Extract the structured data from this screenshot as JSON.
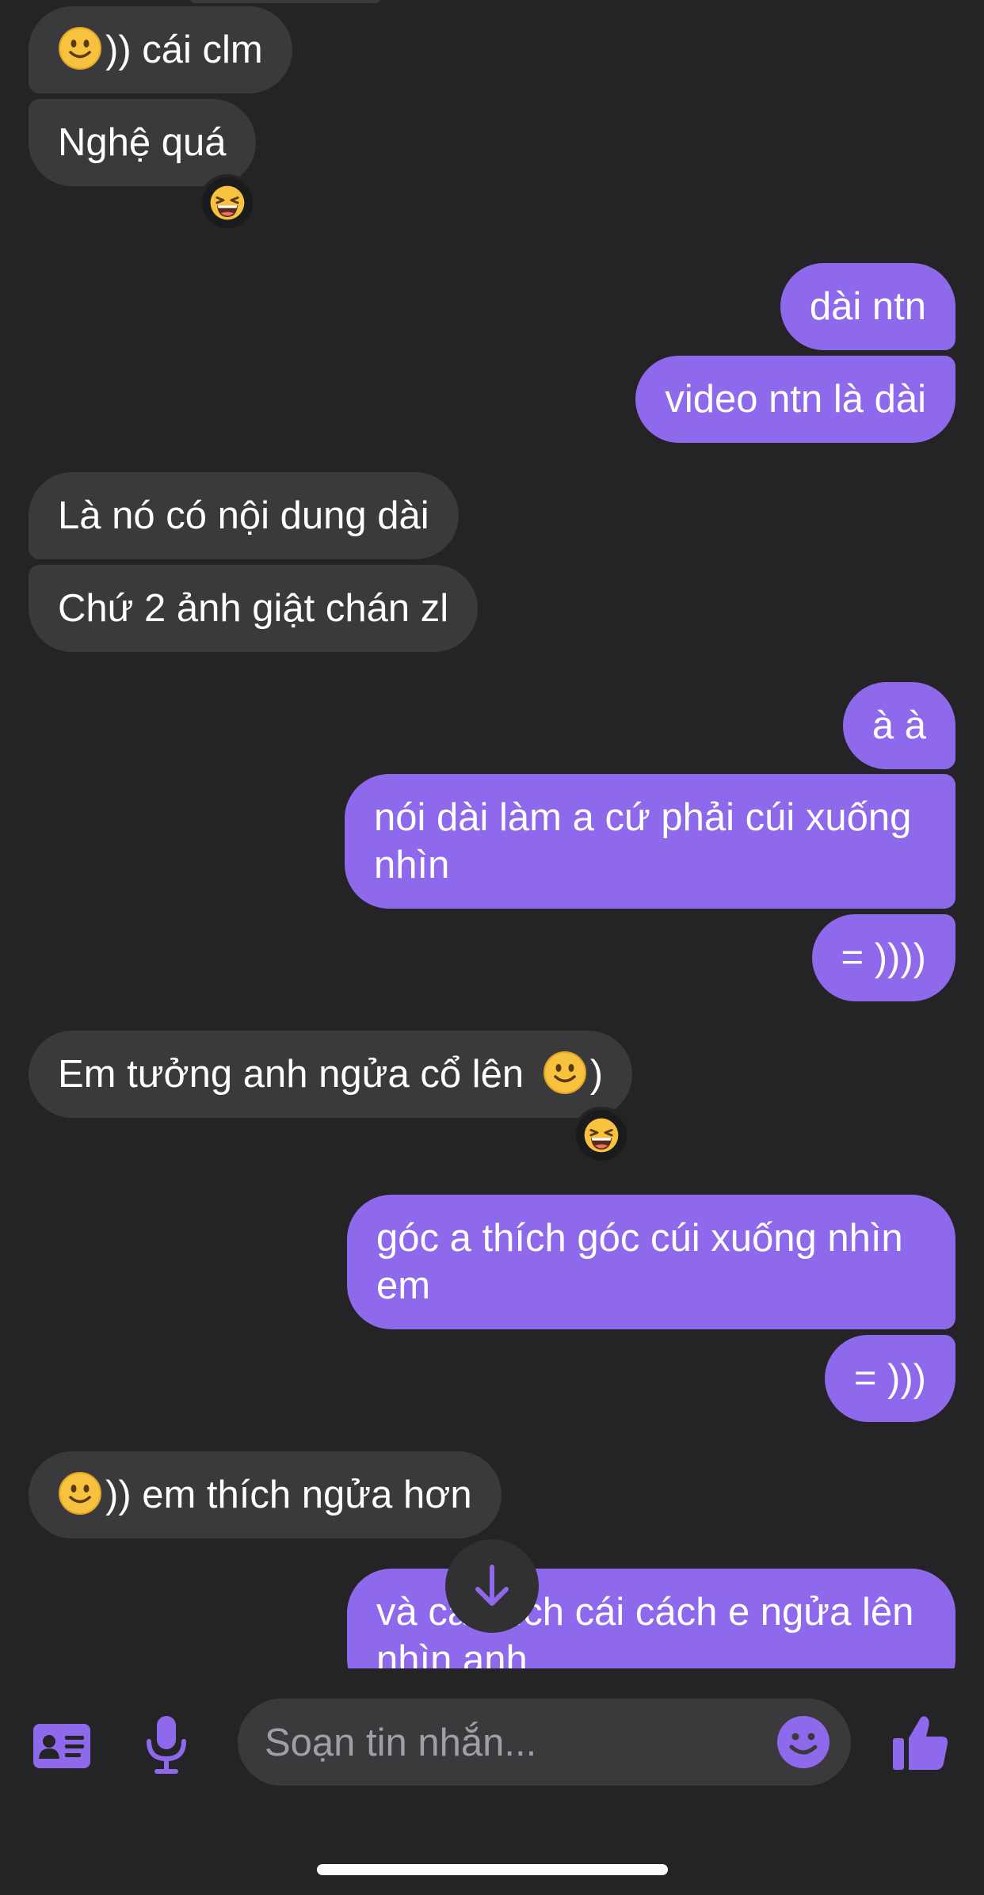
{
  "colors": {
    "background": "#242427",
    "incoming_bubble": "#3a3a3d",
    "outgoing_bubble": "#8f69ec",
    "accent": "#8f69ec"
  },
  "messages": [
    {
      "side": "in",
      "emoji": "slightly-smiling-face",
      "text": ")) cái clm"
    },
    {
      "side": "in",
      "text": "Nghệ quá",
      "reaction": "grinning-squinting-face"
    },
    {
      "side": "out",
      "text": "dài ntn"
    },
    {
      "side": "out",
      "text": "video ntn là dài"
    },
    {
      "side": "in",
      "text": "Là nó có nội dung dài"
    },
    {
      "side": "in",
      "text": "Chứ 2 ảnh giật chán zl"
    },
    {
      "side": "out",
      "text": "à à"
    },
    {
      "side": "out",
      "text": "nói dài làm a cứ phải cúi xuống nhìn"
    },
    {
      "side": "out",
      "text": "= ))))"
    },
    {
      "side": "in",
      "text": "Em tưởng anh ngửa cổ lên",
      "emoji_after": "slightly-smiling-face",
      "text_after": ")",
      "reaction": "grinning-squinting-face"
    },
    {
      "side": "out",
      "text": "góc a thích góc cúi xuống nhìn em"
    },
    {
      "side": "out",
      "text": "= )))"
    },
    {
      "side": "in",
      "emoji": "slightly-smiling-face",
      "text": ")) em thích ngửa hơn"
    },
    {
      "side": "out",
      "text": "và cả thích cái cách e ngửa lên nhìn anh"
    }
  ],
  "scroll_button": {
    "icon": "arrow-down-icon"
  },
  "composer": {
    "placeholder": "Soạn tin nhắn...",
    "value": "",
    "left_icons": [
      "contact-card-icon",
      "microphone-icon"
    ],
    "emoji_icon": "smiley-icon",
    "like_icon": "thumbs-up-icon"
  }
}
